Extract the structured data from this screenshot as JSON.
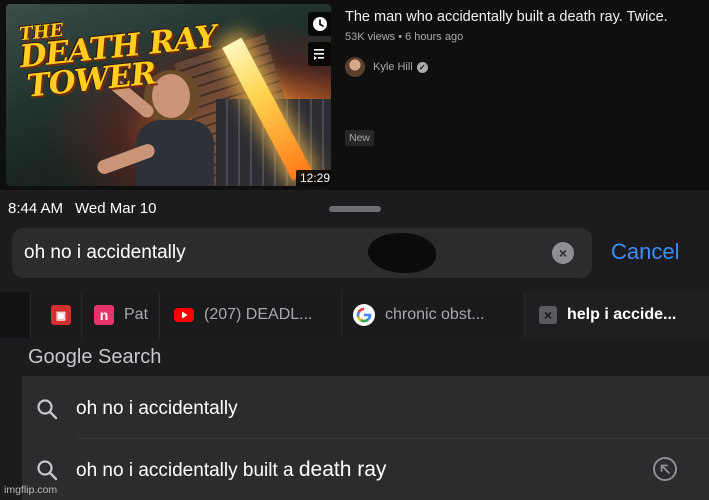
{
  "video": {
    "thumbnail_text": {
      "line1": "THE",
      "line2": "DEATH RAY",
      "line3": "TOWER"
    },
    "duration": "12:29",
    "title": "The man who accidentally built a death ray. Twice.",
    "meta": "53K views • 6 hours ago",
    "channel": "Kyle Hill",
    "badge": "New",
    "icons": {
      "watch_later": "clock-icon",
      "queue": "add-to-queue-icon",
      "verified": "verified-check-icon"
    }
  },
  "status_bar": {
    "time": "8:44 AM",
    "date": "Wed Mar 10"
  },
  "search": {
    "query": "oh no i accidentally",
    "cancel_label": "Cancel"
  },
  "tabs": [
    {
      "label": "",
      "favicon": "red-box-favicon",
      "favicon_color": "#d32f2f"
    },
    {
      "label": "Pat",
      "favicon": "n-favicon",
      "favicon_color": "#e8336b"
    },
    {
      "label": "(207) DEADL...",
      "favicon": "youtube-favicon",
      "favicon_color": "#ff0000"
    },
    {
      "label": "chronic obst...",
      "favicon": "google-favicon",
      "favicon_color": "#4285f4"
    },
    {
      "label": "help i accide...",
      "favicon": "close-tab-icon",
      "active": true
    }
  ],
  "suggestions_header": "Google Search",
  "suggestions": [
    {
      "prefix": "oh no i accidentally",
      "suffix": ""
    },
    {
      "prefix": "oh no i accidentally built a ",
      "suffix": "death ray"
    }
  ],
  "watermark": "imgflip.com",
  "colors": {
    "accent_blue": "#3a8ef6",
    "youtube_bg": "#0f0f0f",
    "ios_bg": "#1c1c1e"
  }
}
